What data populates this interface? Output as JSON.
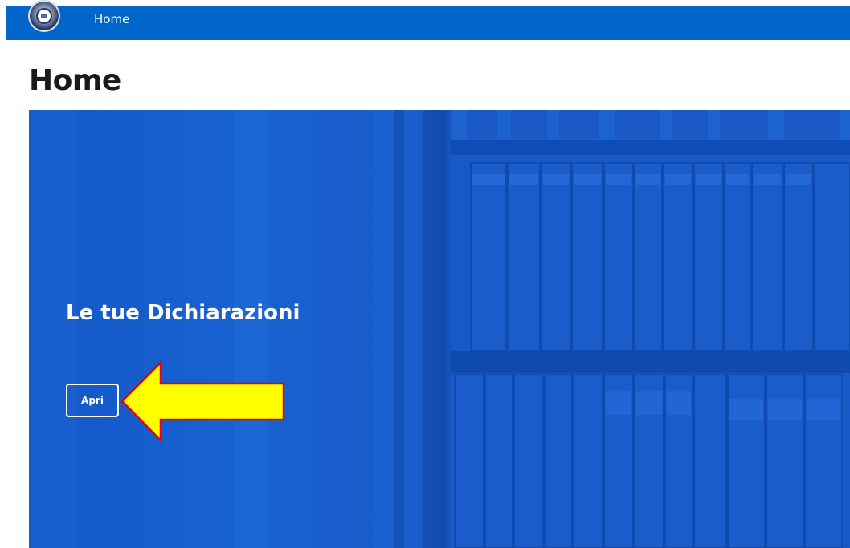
{
  "header": {
    "nav_home_label": "Home",
    "bar_color": "#0066cc",
    "logo_icon": "university-seal-icon"
  },
  "page": {
    "title": "Home"
  },
  "hero": {
    "title": "Le tue Dichiarazioni",
    "button_label": "Apri",
    "background_icon": "bookshelf-image"
  },
  "annotation": {
    "arrow_icon": "yellow-arrow-pointing-left-icon",
    "arrow_fill": "#ffff00",
    "arrow_stroke": "#e60000"
  }
}
